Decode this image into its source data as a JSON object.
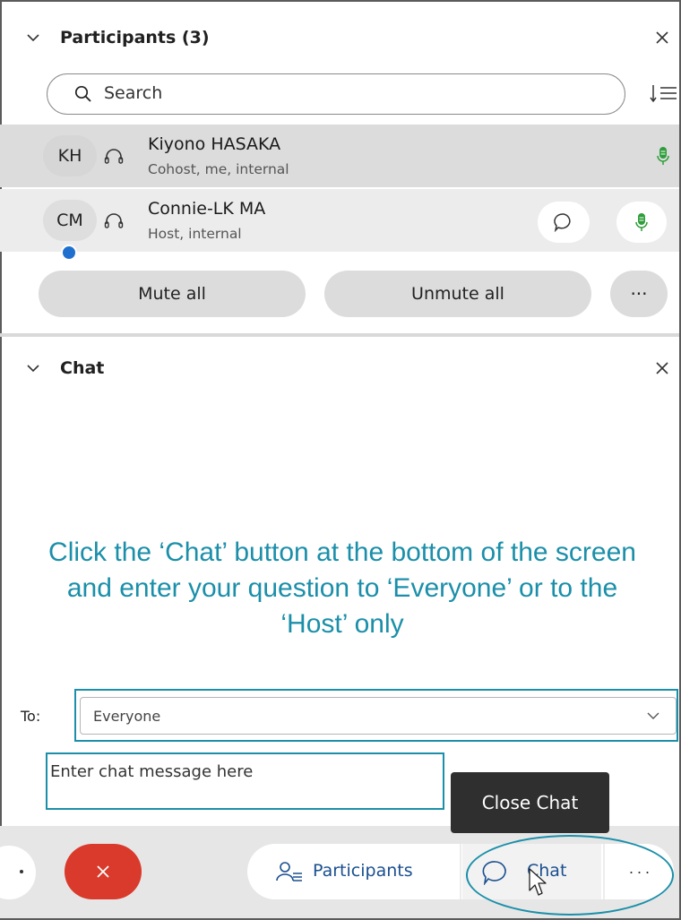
{
  "participants_panel": {
    "title": "Participants (3)",
    "search_placeholder": "Search",
    "participants": [
      {
        "initials": "KH",
        "name": "Kiyono HASAKA",
        "role": "Cohost, me, internal"
      },
      {
        "initials": "CM",
        "name": "Connie-LK MA",
        "role": "Host, internal"
      }
    ],
    "mute_all_label": "Mute all",
    "unmute_all_label": "Unmute all",
    "more_label": "···"
  },
  "chat_panel": {
    "title": "Chat",
    "instruction": "Click the ‘Chat’ button at the bottom of the screen and enter your question to ‘Everyone’ or to the ‘Host’ only",
    "to_label": "To:",
    "to_value": "Everyone",
    "message_placeholder": "Enter chat message here"
  },
  "tooltip": {
    "text": "Close Chat"
  },
  "bottom_bar": {
    "participants_label": "Participants",
    "chat_label": "Chat",
    "more_label": "···"
  },
  "colors": {
    "accent": "#1b8fa9",
    "end_call": "#d93a2b",
    "mic_active": "#2e9e3a",
    "link_text": "#1a4f8f"
  },
  "icons": [
    "chevron-down-icon",
    "close-icon",
    "search-icon",
    "sort-icon",
    "headset-icon",
    "microphone-icon",
    "chat-bubble-icon",
    "participants-icon",
    "end-call-icon",
    "cursor-icon"
  ]
}
